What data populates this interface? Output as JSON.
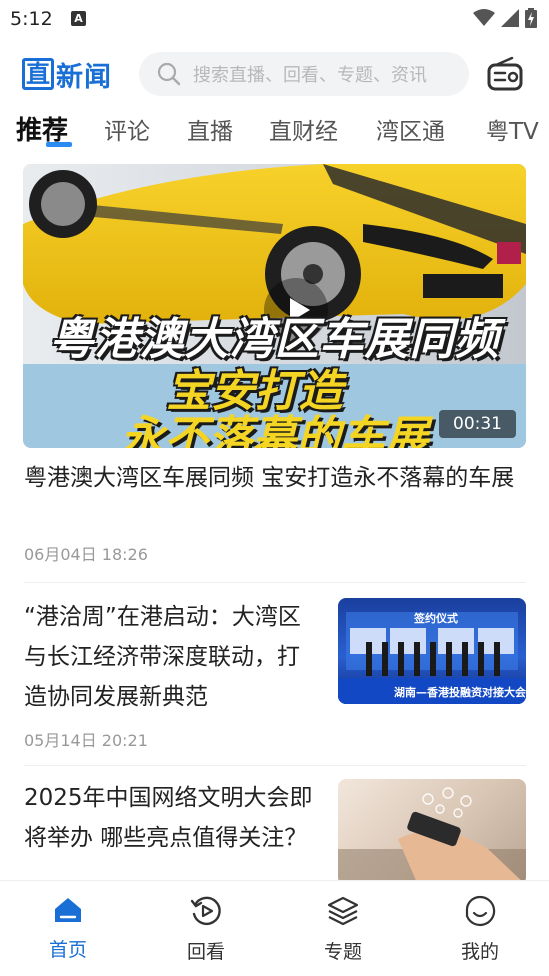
{
  "status_bar": {
    "time": "5:12",
    "notification_badge": "A",
    "icons": [
      "wifi-icon",
      "cell-signal-icon",
      "battery-charging-icon"
    ]
  },
  "header": {
    "logo_first_char": "直",
    "logo_rest": "新闻",
    "search_placeholder": "搜索直播、回看、专题、资讯",
    "accent_color": "#1a6fd6"
  },
  "tabs": [
    {
      "label": "推荐",
      "active": true
    },
    {
      "label": "评论",
      "active": false
    },
    {
      "label": "直播",
      "active": false
    },
    {
      "label": "直财经",
      "active": false
    },
    {
      "label": "湾区通",
      "active": false
    },
    {
      "label": "粤TV",
      "active": false
    }
  ],
  "video_card": {
    "overlay_line1": "粤港澳大湾区车展同频",
    "overlay_line2": "宝安打造",
    "overlay_line3": "永不落幕的车展",
    "duration": "00:31",
    "title": "粤港澳大湾区车展同频 宝安打造永不落幕的车展",
    "date": "06月04日 18:26"
  },
  "news": [
    {
      "title": "“港洽周”在港启动：大湾区与长江经济带深度联动，打造协同发展新典范",
      "date": "05月14日 20:21",
      "thumb_caption": "签约仪式",
      "thumb_banner": "湖南—香港投融资对接大会"
    },
    {
      "title": "2025年中国网络文明大会即将举办 哪些亮点值得关注？",
      "date": ""
    }
  ],
  "bottom_nav": [
    {
      "label": "首页",
      "icon": "home-icon",
      "active": true
    },
    {
      "label": "回看",
      "icon": "replay-icon",
      "active": false
    },
    {
      "label": "专题",
      "icon": "layers-icon",
      "active": false
    },
    {
      "label": "我的",
      "icon": "profile-icon",
      "active": false
    }
  ]
}
